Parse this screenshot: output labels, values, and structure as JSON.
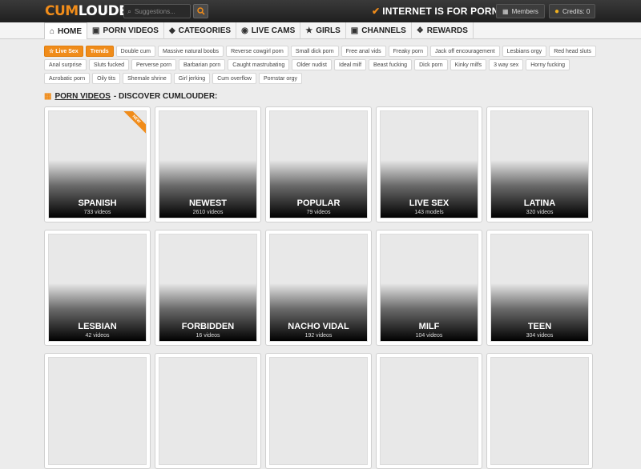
{
  "header": {
    "logo_cum": "CUM",
    "logo_louder": "LOUDER",
    "search_placeholder": "Suggestions...",
    "slogan": "INTERNET IS FOR PORN",
    "members_label": "Members",
    "credits_label": "Credits: 0"
  },
  "nav": [
    {
      "label": "HOME",
      "icon": "home-icon"
    },
    {
      "label": "PORN VIDEOS",
      "icon": "tv-icon"
    },
    {
      "label": "CATEGORIES",
      "icon": "tag-icon"
    },
    {
      "label": "LIVE CAMS",
      "icon": "eye-icon"
    },
    {
      "label": "GIRLS",
      "icon": "star-icon"
    },
    {
      "label": "CHANNELS",
      "icon": "tv-icon"
    },
    {
      "label": "REWARDS",
      "icon": "wings-icon"
    }
  ],
  "tags": [
    "Live Sex",
    "Trends",
    "Double cum",
    "Massive natural boobs",
    "Reverse cowgirl porn",
    "Small dick porn",
    "Free anal vids",
    "Freaky porn",
    "Jack off encouragement",
    "Lesbians orgy",
    "Red head sluts",
    "Anal surprise",
    "Sluts fucked",
    "Perverse porn",
    "Barbarian porn",
    "Caught mastrubating",
    "Older nudist",
    "Ideal milf",
    "Beast fucking",
    "Dick porn",
    "Kinky milfs",
    "3 way sex",
    "Horny fucking",
    "Acrobatic porn",
    "Oily tits",
    "Shemale shrine",
    "Girl jerking",
    "Cum overflow",
    "Pornstar orgy"
  ],
  "section": {
    "title_link": "PORN VIDEOS",
    "title_rest": " - DISCOVER CUMLOUDER:"
  },
  "cards": [
    {
      "title": "SPANISH",
      "count": "733 videos",
      "ribbon": "NEW"
    },
    {
      "title": "NEWEST",
      "count": "2610 videos"
    },
    {
      "title": "POPULAR",
      "count": "79 videos"
    },
    {
      "title": "LIVE SEX",
      "count": "143 models"
    },
    {
      "title": "LATINA",
      "count": "320 videos"
    },
    {
      "title": "LESBIAN",
      "count": "42 videos"
    },
    {
      "title": "FORBIDDEN",
      "count": "16 videos"
    },
    {
      "title": "NACHO VIDAL",
      "count": "192 videos"
    },
    {
      "title": "MILF",
      "count": "104 videos"
    },
    {
      "title": "TEEN",
      "count": "304 videos"
    },
    {
      "title": "",
      "count": ""
    },
    {
      "title": "",
      "count": ""
    },
    {
      "title": "",
      "count": ""
    },
    {
      "title": "",
      "count": ""
    },
    {
      "title": "",
      "count": ""
    }
  ],
  "colors": {
    "accent": "#f08c1a",
    "header_bg": "#2a2a2a"
  }
}
